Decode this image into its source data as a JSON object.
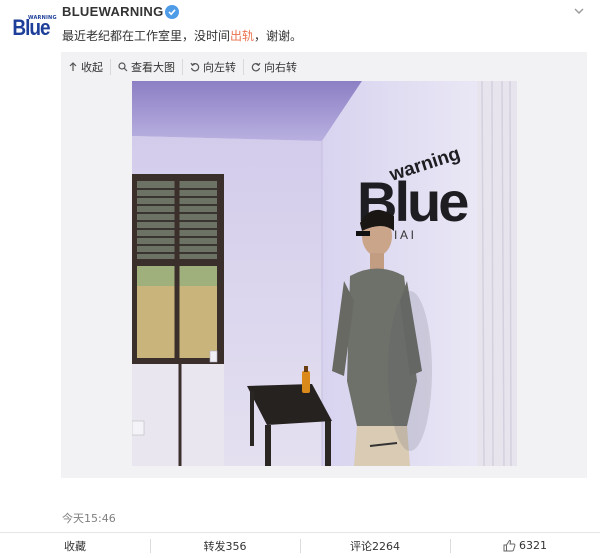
{
  "user": {
    "name": "BLUEWARNING",
    "avatar_text": "Blue",
    "avatar_small_text": "WARNING"
  },
  "post": {
    "text_before": "最近老纪都在工作室里，没时间",
    "text_highlight": "出轨",
    "text_after": "，谢谢。",
    "time": "今天15:46"
  },
  "media_toolbar": {
    "collapse": "收起",
    "view_large": "查看大图",
    "rotate_left": "向左转",
    "rotate_right": "向右转"
  },
  "photo": {
    "wall_logo_main": "Blue",
    "wall_logo_sub": "warning",
    "wall_logo_tail": "I  A  I"
  },
  "actions": {
    "favorite": "收藏",
    "repost": "转发356",
    "comment": "评论2264",
    "like": "6321"
  },
  "colors": {
    "brand_blue": "#1d3f9a",
    "highlight": "#eb7350",
    "verified": "#4e9be8",
    "media_bg": "#f2f2f5"
  }
}
